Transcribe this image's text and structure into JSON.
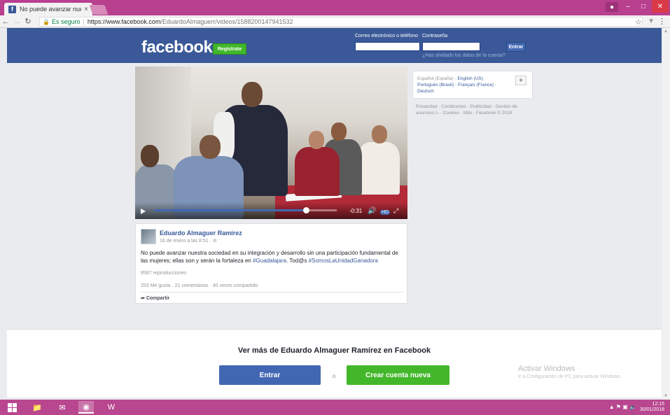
{
  "browser": {
    "tab_title": "No puede avanzar nuest",
    "tab_close": "×",
    "secure_label": "Es seguro",
    "url_host": "https://www.facebook.com",
    "url_path": "/EduardoAlmaguerr/videos/1588200147941532"
  },
  "header": {
    "logo": "facebook",
    "register_label": "Regístrate",
    "email_label": "Correo electrónico o teléfono",
    "password_label": "Contraseña",
    "login_label": "Entrar",
    "forgot_label": "¿Has olvidado los datos de la cuenta?"
  },
  "video": {
    "time": "-0:31",
    "hd": "HD",
    "progress_fraction": 0.83
  },
  "post": {
    "author": "Eduardo Almaguer Ramírez",
    "date": "16 de enero a las 8:51 · ⊘",
    "text_main": "No puede avanzar nuestra sociedad en su integración y desarrollo sin una participación fundamental de las mujeres; ellas son y serán la fortaleza en ",
    "tag1": "#Guadalajara",
    "text_mid": ". Tod@s ",
    "tag2": "#SomosLaUnidadGanadora",
    "views": "8587 reproducciones",
    "stats": "253 Me gusta · 21 comentarios · 40 veces compartido",
    "share": "Compartir"
  },
  "languages": {
    "current": "Español (España)",
    "items": [
      "English (US)",
      "Português (Brasil)",
      "Français (France)",
      "Deutsch"
    ],
    "plus": "+"
  },
  "footer": {
    "links": "Privacidad · Condiciones · Publicidad · Gestión de anuncios ▷ · Cookies · Más · Facebook © 2018"
  },
  "banner": {
    "title": "Ver más de Eduardo Almaguer Ramírez en Facebook",
    "enter_label": "Entrar",
    "or_label": "o",
    "create_label": "Crear cuenta nueva"
  },
  "watermark": {
    "title": "Activar Windows",
    "subtitle": "Ir a Configuración de PC para activar Windows."
  },
  "taskbar": {
    "time": "12:15",
    "date": "30/01/2018"
  }
}
